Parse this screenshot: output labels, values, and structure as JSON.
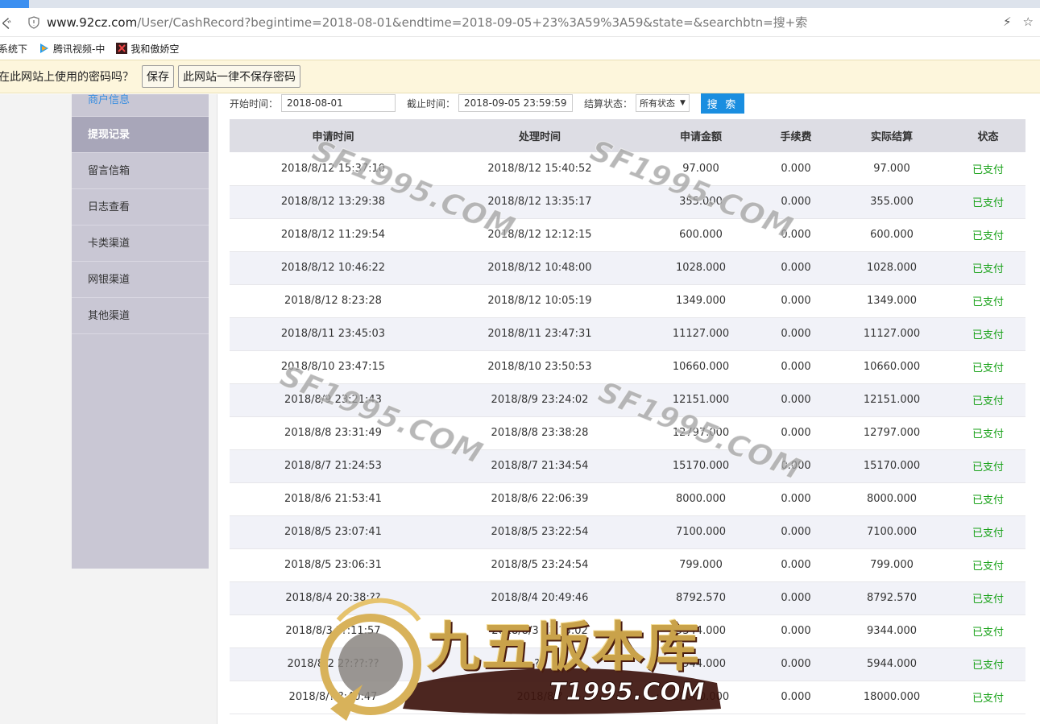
{
  "browser": {
    "url_host": "www.92cz.com",
    "url_rest": "/User/CashRecord?begintime=2018-08-01&endtime=2018-09-05+23%3A59%3A59&state=&searchbtn=搜+索",
    "bookmarks": [
      {
        "label": "系统下"
      },
      {
        "label": "腾讯视频-中"
      },
      {
        "label": "我和傲娇空"
      }
    ]
  },
  "password_bar": {
    "question": "在此网站上使用的密码吗？",
    "save_label": "保存",
    "never_label": "此网站一律不保存密码"
  },
  "sidebar": {
    "items": [
      {
        "label": "商户信息"
      },
      {
        "label": "提现记录"
      },
      {
        "label": "留言信箱"
      },
      {
        "label": "日志查看"
      },
      {
        "label": "卡类渠道"
      },
      {
        "label": "网银渠道"
      },
      {
        "label": "其他渠道"
      }
    ]
  },
  "filters": {
    "start_label": "开始时间：",
    "start_value": "2018-08-01",
    "end_label": "截止时间：",
    "end_value": "2018-09-05 23:59:59",
    "state_label": "结算状态：",
    "state_value": "所有状态",
    "search_label": "搜 索"
  },
  "table": {
    "headers": [
      "申请时间",
      "处理时间",
      "申请金额",
      "手续费",
      "实际结算",
      "状态"
    ],
    "rows": [
      [
        "2018/8/12 15:37:10",
        "2018/8/12 15:40:52",
        "97.000",
        "0.000",
        "97.000",
        "已支付"
      ],
      [
        "2018/8/12 13:29:38",
        "2018/8/12 13:35:17",
        "355.000",
        "0.000",
        "355.000",
        "已支付"
      ],
      [
        "2018/8/12 11:29:54",
        "2018/8/12 12:12:15",
        "600.000",
        "0.000",
        "600.000",
        "已支付"
      ],
      [
        "2018/8/12 10:46:22",
        "2018/8/12 10:48:00",
        "1028.000",
        "0.000",
        "1028.000",
        "已支付"
      ],
      [
        "2018/8/12 8:23:28",
        "2018/8/12 10:05:19",
        "1349.000",
        "0.000",
        "1349.000",
        "已支付"
      ],
      [
        "2018/8/11 23:45:03",
        "2018/8/11 23:47:31",
        "11127.000",
        "0.000",
        "11127.000",
        "已支付"
      ],
      [
        "2018/8/10 23:47:15",
        "2018/8/10 23:50:53",
        "10660.000",
        "0.000",
        "10660.000",
        "已支付"
      ],
      [
        "2018/8/9 23:21:43",
        "2018/8/9 23:24:02",
        "12151.000",
        "0.000",
        "12151.000",
        "已支付"
      ],
      [
        "2018/8/8 23:31:49",
        "2018/8/8 23:38:28",
        "12797.000",
        "0.000",
        "12797.000",
        "已支付"
      ],
      [
        "2018/8/7 21:24:53",
        "2018/8/7 21:34:54",
        "15170.000",
        "0.000",
        "15170.000",
        "已支付"
      ],
      [
        "2018/8/6 21:53:41",
        "2018/8/6 22:06:39",
        "8000.000",
        "0.000",
        "8000.000",
        "已支付"
      ],
      [
        "2018/8/5 23:07:41",
        "2018/8/5 23:22:54",
        "7100.000",
        "0.000",
        "7100.000",
        "已支付"
      ],
      [
        "2018/8/5 23:06:31",
        "2018/8/5 23:24:54",
        "799.000",
        "0.000",
        "799.000",
        "已支付"
      ],
      [
        "2018/8/4 20:38:??",
        "2018/8/4 20:49:46",
        "8792.570",
        "0.000",
        "8792.570",
        "已支付"
      ],
      [
        "2018/8/3 ??:11:57",
        "2018/8/3 23:?3:02",
        "9344.000",
        "0.000",
        "9344.000",
        "已支付"
      ],
      [
        "2018/8/2 2?:??:??",
        "??",
        "5944.000",
        "0.000",
        "5944.000",
        "已支付"
      ],
      [
        "2018/8/? ?:40:47",
        "2018/8/?",
        "18000.000",
        "0.000",
        "18000.000",
        "已支付"
      ]
    ]
  },
  "watermarks": {
    "text": "SF1995.COM",
    "logo_brand": "九五版本库",
    "logo_domain": "T1995.COM"
  }
}
